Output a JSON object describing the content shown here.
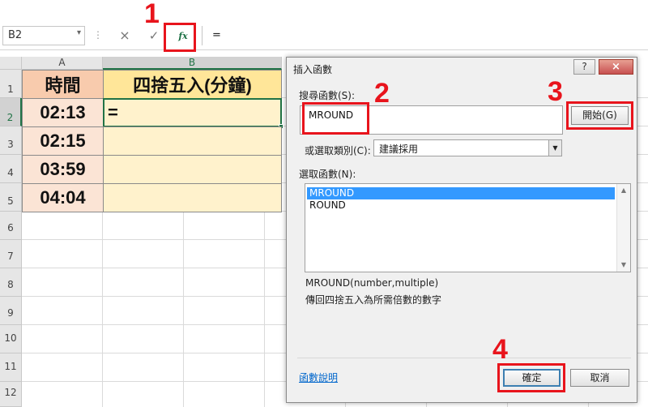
{
  "formula_bar": {
    "name_box": "B2",
    "separator": "⋮",
    "cancel_icon": "×",
    "enter_icon": "✓",
    "fx_label": "fx",
    "formula": "="
  },
  "annotations": [
    "1",
    "2",
    "3",
    "4"
  ],
  "sheet": {
    "columns": [
      "A",
      "B"
    ],
    "rows": [
      "1",
      "2",
      "3",
      "4",
      "5",
      "6",
      "7",
      "8",
      "9",
      "10",
      "11",
      "12"
    ],
    "cells": {
      "A1": "時間",
      "B1": "四捨五入(分鐘)",
      "A2": "02:13",
      "B2": "=",
      "A3": "02:15",
      "A4": "03:59",
      "A5": "04:04"
    }
  },
  "dialog": {
    "title": "插入函數",
    "help_label": "?",
    "close_label": "×",
    "search_label": "搜尋函數(S):",
    "search_value": "MROUND",
    "go_button": "開始(G)",
    "category_label": "或選取類別(C):",
    "category_value": "建議採用",
    "select_label": "選取函數(N):",
    "functions": [
      "MROUND",
      "ROUND"
    ],
    "selected_function": "MROUND",
    "signature": "MROUND(number,multiple)",
    "description": "傳回四捨五入為所需倍數的數字",
    "help_link": "函數說明",
    "ok_button": "確定",
    "cancel_button": "取消"
  },
  "colors": {
    "annotation_red": "#e8141c",
    "excel_green": "#217346",
    "selection_blue": "#3399ff"
  }
}
